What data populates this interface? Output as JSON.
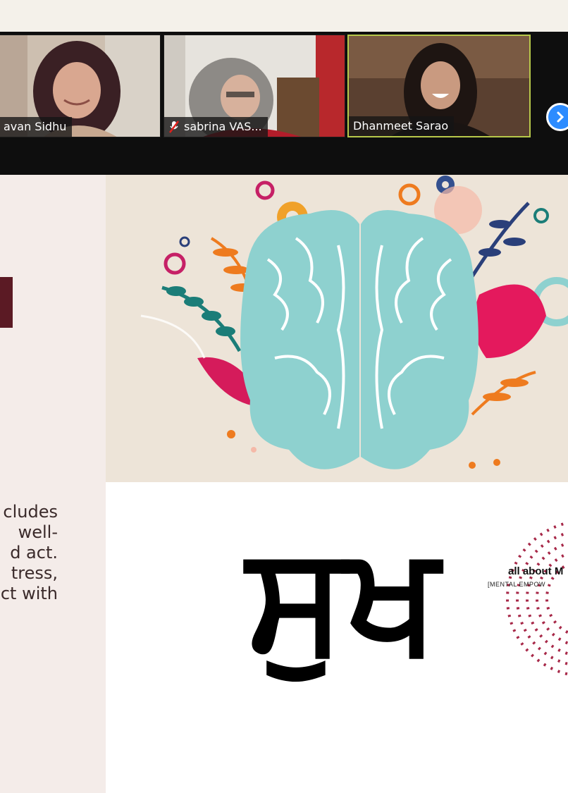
{
  "participants": [
    {
      "name": "avan Sidhu",
      "muted": false,
      "active": false
    },
    {
      "name": "sabrina VAS...",
      "muted": true,
      "active": false
    },
    {
      "name": "Dhanmeet Sarao",
      "muted": false,
      "active": true
    }
  ],
  "gallery": {
    "next_icon": "chevron-right-icon"
  },
  "slide": {
    "body_lines": [
      "cludes",
      "well-",
      "d act.",
      "tress,",
      "ct with"
    ],
    "logo_glyph": "ਸੁਖ",
    "brand_line1": "all about M",
    "brand_line2": "[MENTAL EMPOW"
  },
  "colors": {
    "accent_active": "#b7c84a",
    "zoom_blue": "#2d8cff",
    "title_maroon": "#5b1a24",
    "brain": "#8ed1cf"
  }
}
